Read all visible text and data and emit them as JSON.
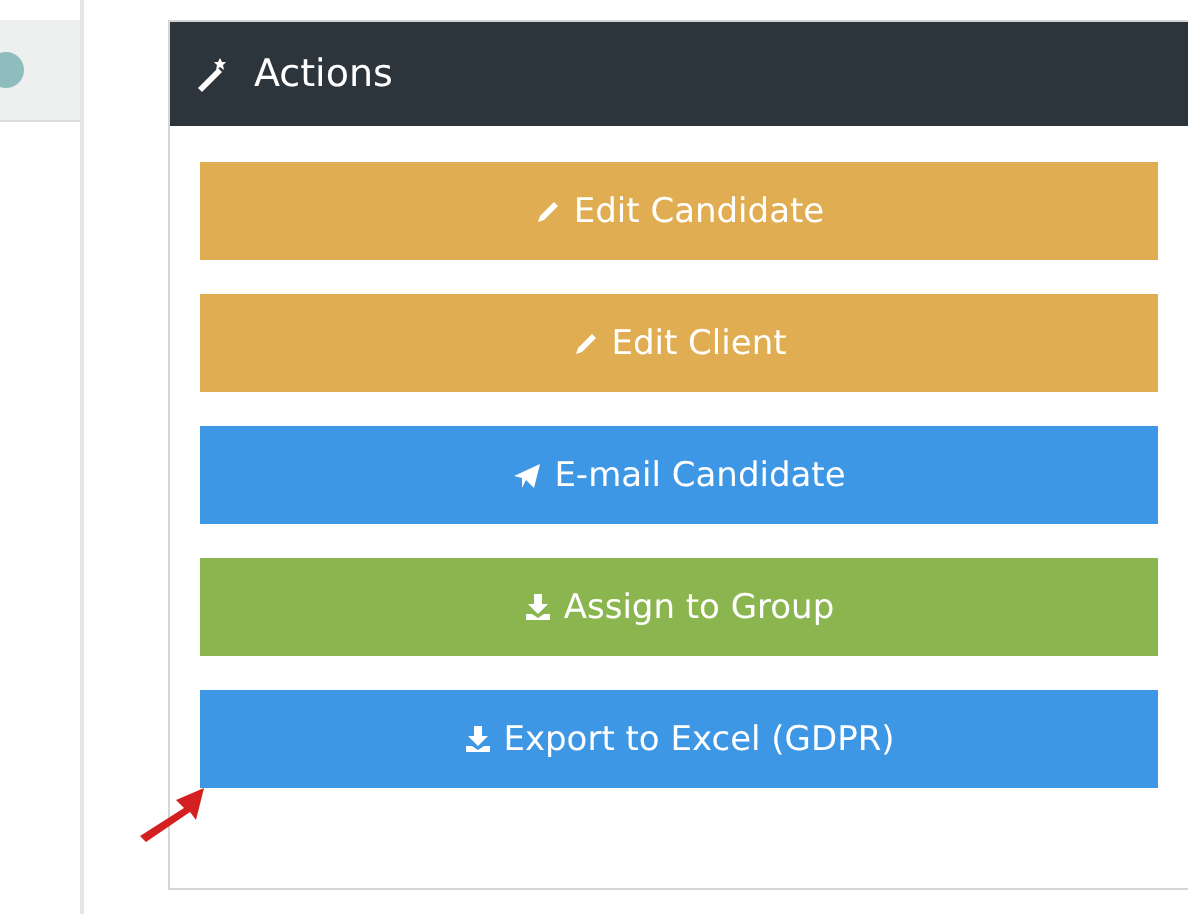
{
  "panel": {
    "title": "Actions"
  },
  "buttons": [
    {
      "label": "Edit Candidate",
      "kind": "edit"
    },
    {
      "label": "Edit Client",
      "kind": "edit"
    },
    {
      "label": "E-mail Candidate",
      "kind": "send"
    },
    {
      "label": "Assign to Group",
      "kind": "assign"
    },
    {
      "label": "Export to Excel (GDPR)",
      "kind": "export"
    }
  ]
}
